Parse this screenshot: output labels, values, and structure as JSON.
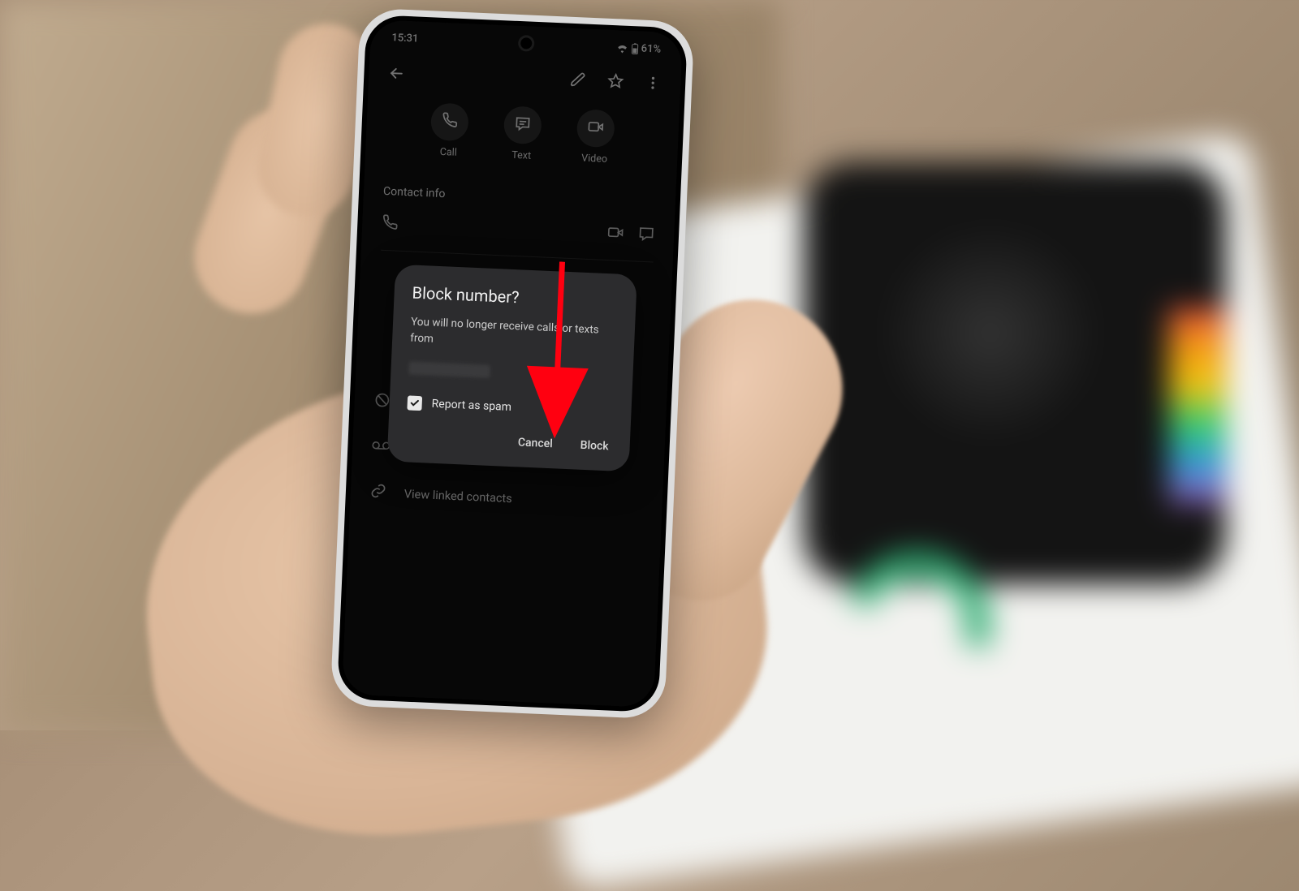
{
  "status_bar": {
    "time": "15:31",
    "battery_text": "61%"
  },
  "quick_actions": {
    "call": {
      "label": "Call"
    },
    "text": {
      "label": "Text"
    },
    "video": {
      "label": "Video"
    }
  },
  "section_contact_info": "Contact info",
  "menu": {
    "block_numbers": "Block numbers",
    "divert_voicemail": "Divert to voicemail",
    "view_linked_contacts": "View linked contacts"
  },
  "dialog": {
    "title": "Block number?",
    "body": "You will no longer receive calls or texts from",
    "checkbox_label": "Report as spam",
    "cancel": "Cancel",
    "confirm": "Block"
  },
  "annotation": {
    "arrow_color": "#ff0010"
  }
}
